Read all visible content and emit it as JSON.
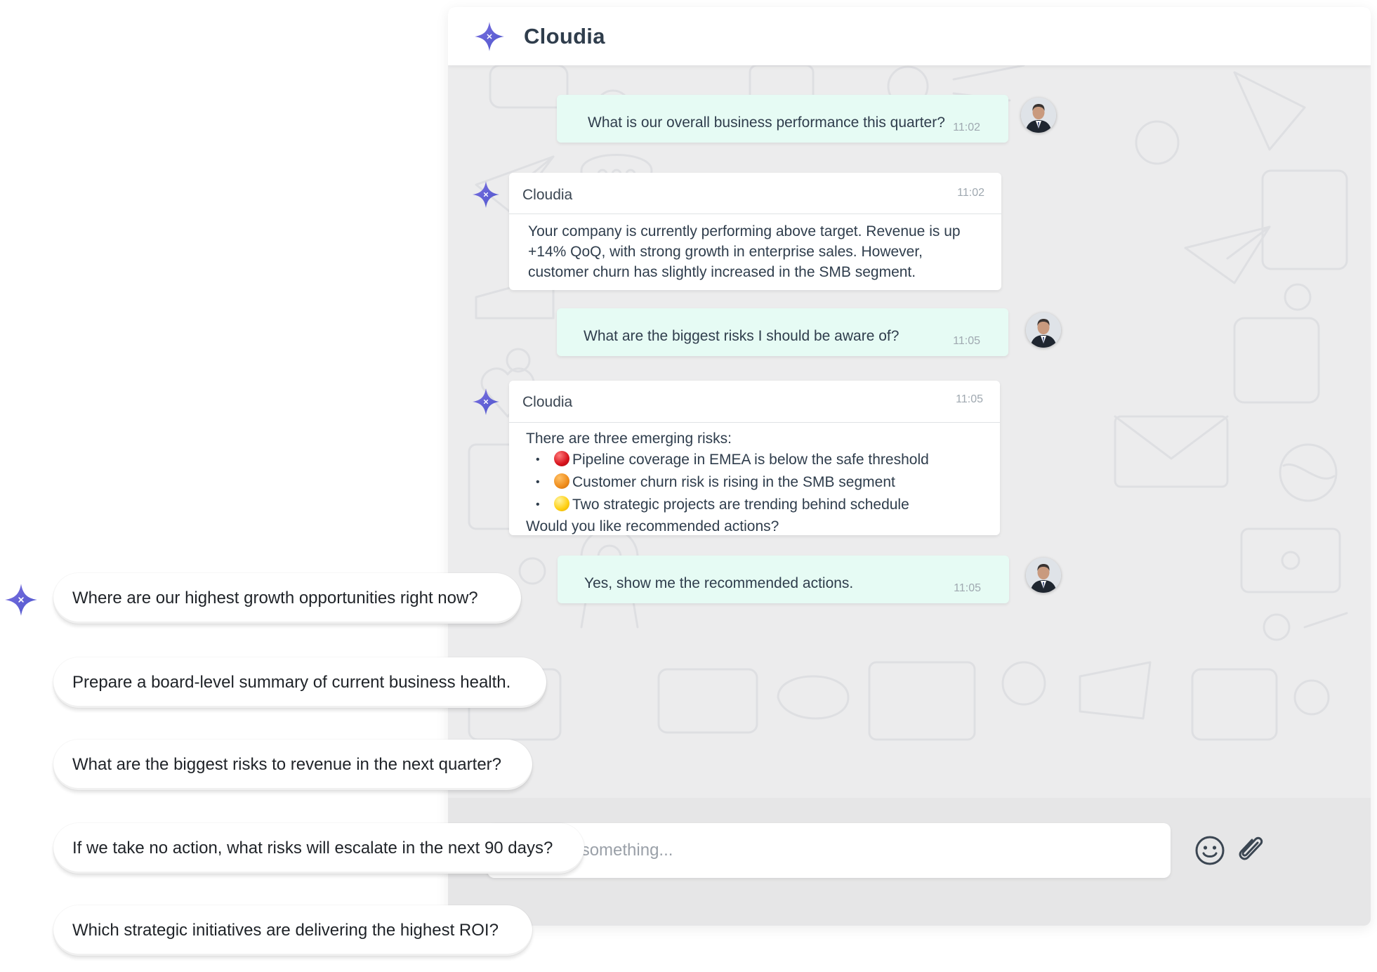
{
  "app": {
    "title": "Cloudia",
    "logo_icon": "four-point-star-icon",
    "brand_color": "#5b5fd6"
  },
  "messages": [
    {
      "role": "user",
      "text": "What is our overall business performance this quarter?",
      "time": "11:02"
    },
    {
      "role": "bot",
      "sender": "Cloudia",
      "time": "11:02",
      "text": "Your company is currently performing above target. Revenue is up +14% QoQ, with strong growth in enterprise sales. However, customer churn has slightly increased in the SMB segment."
    },
    {
      "role": "user",
      "text": "What are the biggest risks I should be aware of?",
      "time": "11:05"
    },
    {
      "role": "bot",
      "sender": "Cloudia",
      "time": "11:05",
      "intro": "There are three emerging risks:",
      "risks": [
        {
          "status_color": "#e0242c",
          "text": "Pipeline coverage in EMEA is below the safe threshold"
        },
        {
          "status_color": "#ef8c1b",
          "text": "Customer churn risk is rising in the SMB segment"
        },
        {
          "status_color": "#ffcf10",
          "text": "Two strategic projects are trending behind schedule"
        }
      ],
      "outro": "Would you like recommended actions?"
    },
    {
      "role": "user",
      "text": "Yes, show me the recommended actions.",
      "time": "11:05"
    }
  ],
  "composer": {
    "placeholder": "Type something...",
    "emoji_icon": "smiley-icon",
    "attach_icon": "paperclip-icon"
  },
  "suggestions": [
    "Where are our highest growth opportunities right now?",
    "Prepare a board-level summary of current business health.",
    "What are the biggest risks to revenue in the next quarter?",
    "If we take no action, what risks will escalate in the next 90 days?",
    "Which strategic initiatives are delivering the highest ROI?"
  ],
  "colors": {
    "user_bubble": "#e6fbf4",
    "bot_bubble": "#ffffff",
    "chat_background": "#ececed"
  }
}
